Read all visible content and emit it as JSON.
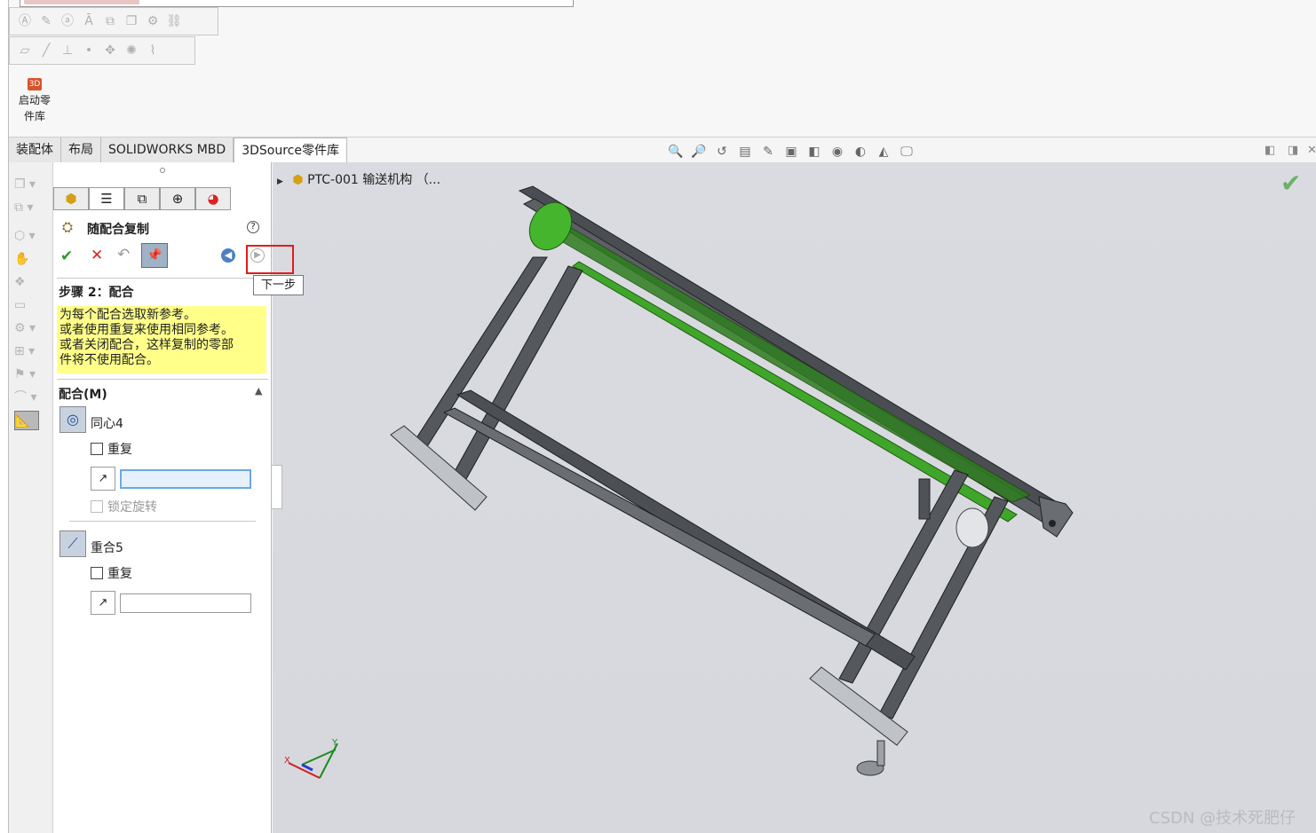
{
  "app": {
    "ribbon_button_lines": [
      "启动零",
      "件库"
    ],
    "tabs": [
      "装配体",
      "布局",
      "SOLIDWORKS MBD",
      "3DSource零件库"
    ]
  },
  "property_manager": {
    "title": "随配合复制",
    "help_glyph": "?",
    "tooltip": "下一步",
    "step_title": "步骤 2：配合",
    "note_lines": [
      "为每个配合选取新参考。",
      "或者使用重复来使用相同参考。",
      "或者关闭配合，这样复制的零部",
      "件将不使用配合。"
    ],
    "mates_section": "配合(M)",
    "mate1": {
      "name": "同心4",
      "repeat": "重复",
      "lock": "锁定旋转"
    },
    "mate2": {
      "name": "重合5",
      "repeat": "重复"
    }
  },
  "viewport": {
    "tree_item": "PTC-001 输送机构 （...",
    "watermark": "CSDN @技术死肥仔"
  },
  "icons": {
    "ok": "✔",
    "cancel": "✕",
    "undo": "↶",
    "pin": "📌",
    "back": "◀",
    "next": "▶"
  },
  "colors": {
    "accent_green": "#4aa829",
    "highlight_red": "#e21b1b",
    "note_yellow": "#ffff8a"
  }
}
